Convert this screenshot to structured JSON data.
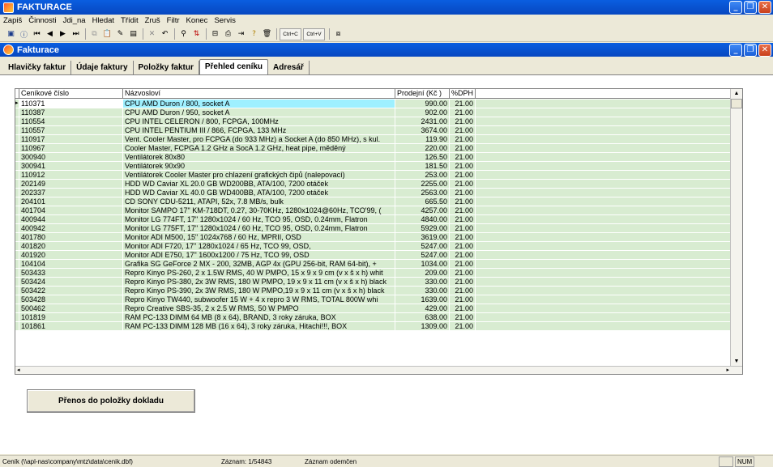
{
  "app": {
    "title": "FAKTURACE"
  },
  "menu": [
    "Zapiš",
    "Činnosti",
    "Jdi_na",
    "Hledat",
    "Třídit",
    "Zruš",
    "Filtr",
    "Konec",
    "Servis"
  ],
  "toolbar": {
    "ctrl_c": "Ctrl+C",
    "ctrl_v": "Ctrl+V"
  },
  "window": {
    "title": "Fakturace"
  },
  "tabs": [
    {
      "label": "Hlavičky faktur"
    },
    {
      "label": "Údaje faktury"
    },
    {
      "label": "Položky faktur"
    },
    {
      "label": "Přehled ceníku"
    },
    {
      "label": "Adresář"
    }
  ],
  "grid": {
    "columns": [
      "Ceníkové číslo",
      "Názvosloví",
      "Prodejní (Kč )",
      "%DPH"
    ],
    "rows": [
      {
        "code": "110371",
        "name": "CPU AMD Duron / 800, socket A",
        "price": "990.00",
        "vat": "21.00"
      },
      {
        "code": "110387",
        "name": "CPU AMD Duron / 950, socket A",
        "price": "902.00",
        "vat": "21.00"
      },
      {
        "code": "110554",
        "name": "CPU INTEL CELERON / 800, FCPGA, 100MHz",
        "price": "2431.00",
        "vat": "21.00"
      },
      {
        "code": "110557",
        "name": "CPU INTEL PENTIUM III / 866, FCPGA, 133 MHz",
        "price": "3674.00",
        "vat": "21.00"
      },
      {
        "code": "110917",
        "name": "Vent. Cooler Master, pro FCPGA (do 933 MHz) a Socket A (do 850 MHz), s kul.",
        "price": "119.90",
        "vat": "21.00"
      },
      {
        "code": "110967",
        "name": "Cooler Master, FCPGA 1.2 GHz a SocA 1.2 GHz, heat pipe, měděný",
        "price": "220.00",
        "vat": "21.00"
      },
      {
        "code": "300940",
        "name": "Ventilátorek 80x80",
        "price": "126.50",
        "vat": "21.00"
      },
      {
        "code": "300941",
        "name": "Ventilátorek 90x90",
        "price": "181.50",
        "vat": "21.00"
      },
      {
        "code": "110912",
        "name": "Ventilátorek Cooler Master pro chlazení grafických čipů (nalepovací)",
        "price": "253.00",
        "vat": "21.00"
      },
      {
        "code": "202149",
        "name": "HDD WD Caviar XL 20.0 GB  WD200BB, ATA/100, 7200 otáček",
        "price": "2255.00",
        "vat": "21.00"
      },
      {
        "code": "202337",
        "name": "HDD WD Caviar XL 40.0 GB  WD400BB, ATA/100, 7200 otáček",
        "price": "2563.00",
        "vat": "21.00"
      },
      {
        "code": "204101",
        "name": "CD SONY CDU-5211, ATAPI, 52x, 7.8 MB/s, bulk",
        "price": "665.50",
        "vat": "21.00"
      },
      {
        "code": "401704",
        "name": "Monitor SAMPO 17\" KM-718DT, 0.27, 30-70KHz, 1280x1024@60Hz, TCO'99, (",
        "price": "4257.00",
        "vat": "21.00"
      },
      {
        "code": "400944",
        "name": "Monitor LG 774FT, 17\" 1280x1024 / 60 Hz, TCO 95, OSD, 0.24mm, Flatron",
        "price": "4840.00",
        "vat": "21.00"
      },
      {
        "code": "400942",
        "name": "Monitor LG 775FT, 17\" 1280x1024 / 60 Hz, TCO 95, OSD, 0.24mm, Flatron",
        "price": "5929.00",
        "vat": "21.00"
      },
      {
        "code": "401780",
        "name": "Monitor ADI M500, 15\" 1024x768 / 60 Hz, MPRII, OSD",
        "price": "3619.00",
        "vat": "21.00"
      },
      {
        "code": "401820",
        "name": "Monitor ADI F720, 17\" 1280x1024 / 65 Hz, TCO 99, OSD,",
        "price": "5247.00",
        "vat": "21.00"
      },
      {
        "code": "401920",
        "name": "Monitor ADI E750, 17\" 1600x1200 / 75 Hz, TCO 99, OSD",
        "price": "5247.00",
        "vat": "21.00"
      },
      {
        "code": "104104",
        "name": "Grafika SG  GeForce 2 MX - 200, 32MB, AGP 4x (GPU 256-bit, RAM 64-bit), +",
        "price": "1034.00",
        "vat": "21.00"
      },
      {
        "code": "503433",
        "name": "Repro Kinyo PS-260, 2 x 1.5W RMS, 40 W PMPO, 15 x 9 x 9 cm  (v x š x h) whit",
        "price": "209.00",
        "vat": "21.00"
      },
      {
        "code": "503424",
        "name": "Repro Kinyo PS-380, 2x 3W RMS, 180 W PMPO, 19 x 9 x 11 cm (v x š x h) black",
        "price": "330.00",
        "vat": "21.00"
      },
      {
        "code": "503422",
        "name": "Repro Kinyo PS-390, 2x 3W RMS, 180 W PMPO,19 x 9 x 11 cm (v x š x h) black",
        "price": "330.00",
        "vat": "21.00"
      },
      {
        "code": "503428",
        "name": "Repro Kinyo TW440, subwoofer 15 W + 4 x repro 3 W RMS, TOTAL 800W  whi",
        "price": "1639.00",
        "vat": "21.00"
      },
      {
        "code": "500462",
        "name": "Repro Creative SBS-35, 2 x 2.5 W RMS, 50 W PMPO",
        "price": "429.00",
        "vat": "21.00"
      },
      {
        "code": "101819",
        "name": "RAM PC-133 DIMM   64 MB (8 x 64), BRAND, 3 roky záruka, BOX",
        "price": "638.00",
        "vat": "21.00"
      },
      {
        "code": "101861",
        "name": "RAM PC-133 DIMM 128 MB (16 x 64), 3 roky záruka, Hitachi!!!, BOX",
        "price": "1309.00",
        "vat": "21.00"
      }
    ]
  },
  "action": {
    "transfer_label": "Přenos do položky dokladu"
  },
  "status": {
    "path": "Ceník (\\\\apl-nas\\company\\mtz\\data\\cenik.dbf)",
    "record": "Záznam: 1/54843",
    "flag": "Záznam odemčen",
    "num": "NUM"
  }
}
